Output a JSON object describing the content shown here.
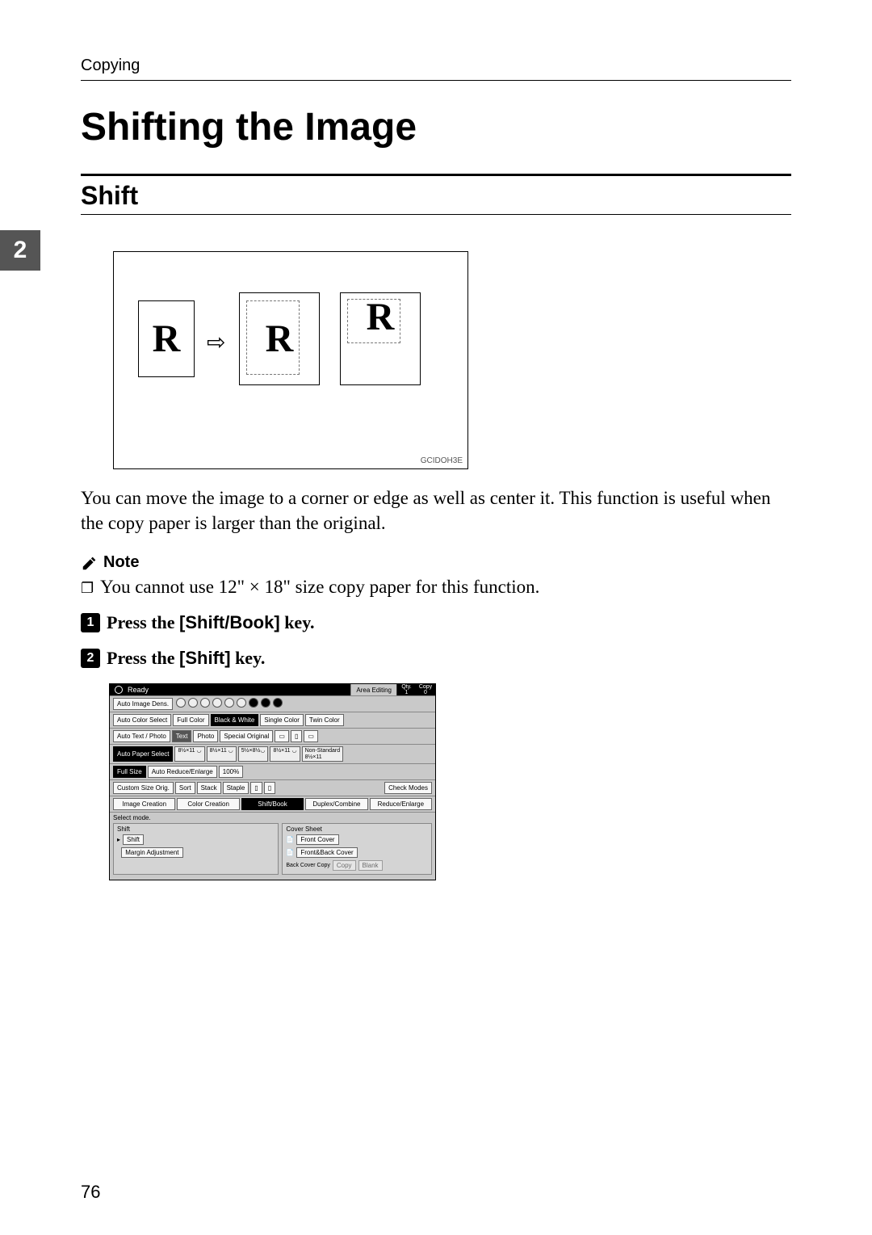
{
  "header": "Copying",
  "title": "Shifting the Image",
  "subtitle": "Shift",
  "chapter_tab": "2",
  "diagram": {
    "glyph_a": "R",
    "glyph_b": "R",
    "glyph_c": "R",
    "arrow": "⇨",
    "code": "GCIDOH3E"
  },
  "body_text": "You can move the image to a corner or edge as well as center it. This function is useful when the copy paper is larger than the original.",
  "note_label": "Note",
  "note_bullet": "❐",
  "note_text": "You cannot use 12\" × 18\" size copy paper for this function.",
  "steps": {
    "s1_pre": "Press the ",
    "s1_key": "[Shift/Book]",
    "s1_post": " key.",
    "s2_pre": "Press the ",
    "s2_key": "[Shift]",
    "s2_post": " key."
  },
  "panel": {
    "status": "Ready",
    "area_edit": "Area Editing",
    "qty_label": "Qty.",
    "qty_value": "1",
    "copy_label": "Copy",
    "copy_value": "0",
    "auto_image_dens": "Auto Image Dens.",
    "auto_color_select": "Auto Color Select",
    "full_color": "Full Color",
    "black_white": "Black & White",
    "single_color": "Single Color",
    "twin_color": "Twin Color",
    "auto_text_photo": "Auto Text / Photo",
    "text": "Text",
    "photo": "Photo",
    "special_original": "Special Original",
    "auto_paper_select": "Auto Paper Select",
    "trays": [
      "8½×11 ◡",
      "8½×11 ◡",
      "5½×8½◡",
      "8½×11 ◡",
      "8½×11"
    ],
    "tray_side": "Non-Standard",
    "full_size": "Full Size",
    "auto_re": "Auto Reduce/Enlarge",
    "pct": "100%",
    "custom_size": "Custom Size Orig.",
    "sort": "Sort",
    "stack": "Stack",
    "staple": "Staple",
    "check_modes": "Check Modes",
    "tabs": [
      "Image Creation",
      "Color Creation",
      "Shift/Book",
      "Duplex/Combine",
      "Reduce/Enlarge"
    ],
    "select_mode": "Select mode.",
    "shift_group": "Shift",
    "shift_btn": "Shift",
    "margin_btn": "Margin Adjustment",
    "cover_group": "Cover Sheet",
    "front_cover": "Front Cover",
    "front_back_cover": "Front&Back Cover",
    "back_cover_copy": "Back Cover Copy",
    "copy_opt": "Copy",
    "blank_opt": "Blank"
  },
  "page_number": "76"
}
